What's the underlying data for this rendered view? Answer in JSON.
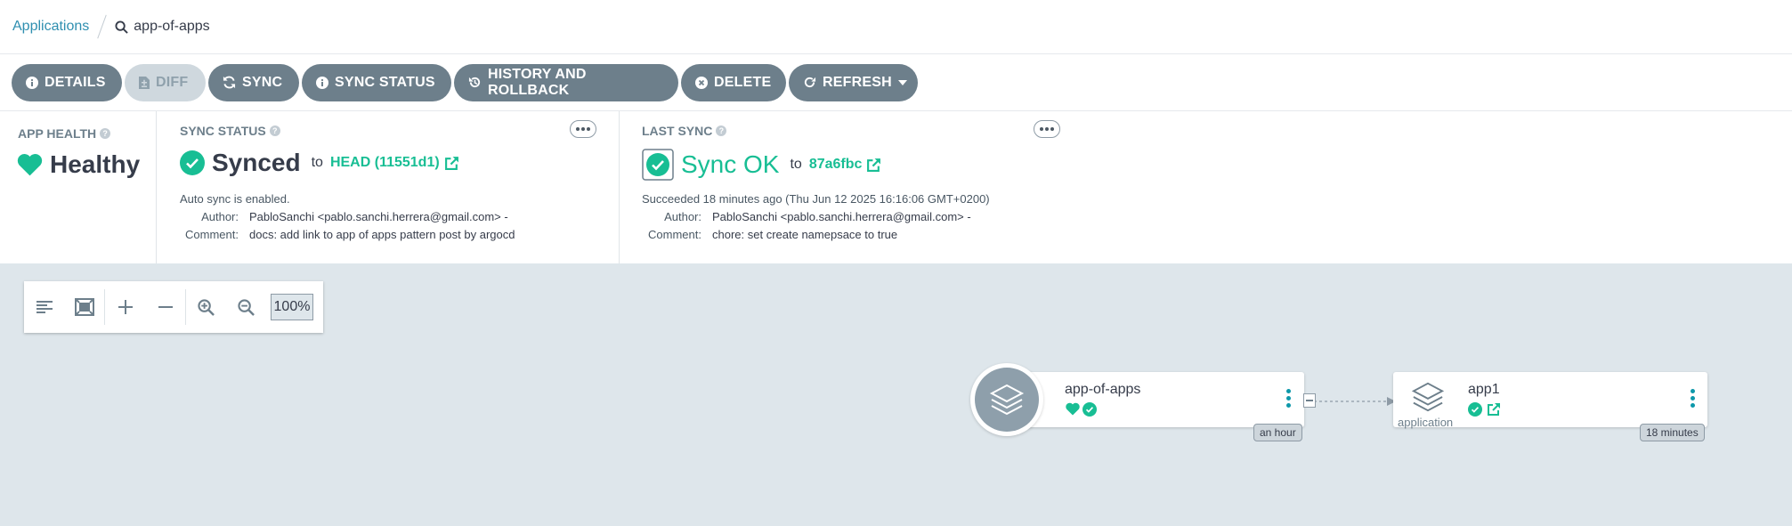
{
  "breadcrumb": {
    "root": "Applications",
    "current": "app-of-apps"
  },
  "toolbar": {
    "details": "DETAILS",
    "diff": "DIFF",
    "sync": "SYNC",
    "sync_status": "SYNC STATUS",
    "history": "HISTORY AND ROLLBACK",
    "delete": "DELETE",
    "refresh": "REFRESH"
  },
  "app_health": {
    "title": "APP HEALTH",
    "status": "Healthy",
    "color": "#18be94"
  },
  "sync_status": {
    "title": "SYNC STATUS",
    "status": "Synced",
    "to": "to",
    "revision": "HEAD (11551d1)",
    "auto_sync": "Auto sync is enabled.",
    "author_label": "Author:",
    "author": "PabloSanchi <pablo.sanchi.herrera@gmail.com> -",
    "comment_label": "Comment:",
    "comment": "docs: add link to app of apps pattern post by argocd"
  },
  "last_sync": {
    "title": "LAST SYNC",
    "status": "Sync OK",
    "to": "to",
    "revision": "87a6fbc",
    "succeeded": "Succeeded 18 minutes ago (Thu Jun 12 2025 16:16:06 GMT+0200)",
    "author_label": "Author:",
    "author": "PabloSanchi <pablo.sanchi.herrera@gmail.com> -",
    "comment_label": "Comment:",
    "comment": "chore: set create namepsace to true"
  },
  "zoom": {
    "level": "100%"
  },
  "graph": {
    "root_node": {
      "name": "app-of-apps",
      "age": "an hour"
    },
    "child_node": {
      "name": "app1",
      "kind": "application",
      "age": "18 minutes"
    }
  },
  "colors": {
    "accent": "#18be94",
    "link": "#2f8fb0",
    "button": "#6d7f8b",
    "canvas": "#dee6eb"
  }
}
